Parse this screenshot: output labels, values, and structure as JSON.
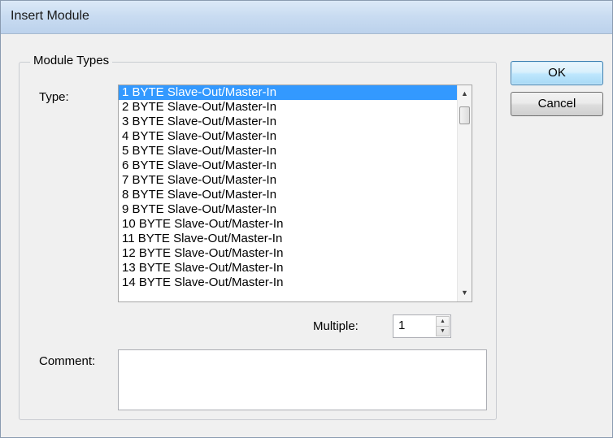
{
  "window": {
    "title": "Insert Module"
  },
  "group": {
    "label": "Module Types"
  },
  "type_field": {
    "label": "Type:",
    "items": [
      "1 BYTE Slave-Out/Master-In",
      "2 BYTE Slave-Out/Master-In",
      "3 BYTE Slave-Out/Master-In",
      "4 BYTE Slave-Out/Master-In",
      "5 BYTE Slave-Out/Master-In",
      "6 BYTE Slave-Out/Master-In",
      "7 BYTE Slave-Out/Master-In",
      "8 BYTE Slave-Out/Master-In",
      "9 BYTE Slave-Out/Master-In",
      "10 BYTE Slave-Out/Master-In",
      "11 BYTE Slave-Out/Master-In",
      "12 BYTE Slave-Out/Master-In",
      "13 BYTE Slave-Out/Master-In",
      "14 BYTE Slave-Out/Master-In"
    ],
    "selected_index": 0
  },
  "multiple": {
    "label": "Multiple:",
    "value": "1"
  },
  "comment": {
    "label": "Comment:",
    "value": ""
  },
  "buttons": {
    "ok": "OK",
    "cancel": "Cancel"
  },
  "icons": {
    "scroll_up": "scroll-up-arrow",
    "scroll_down": "scroll-down-arrow",
    "spin_up": "spin-up-arrow",
    "spin_down": "spin-down-arrow"
  },
  "colors": {
    "selection": "#3399ff",
    "title_bar": "#c8dbf1"
  }
}
